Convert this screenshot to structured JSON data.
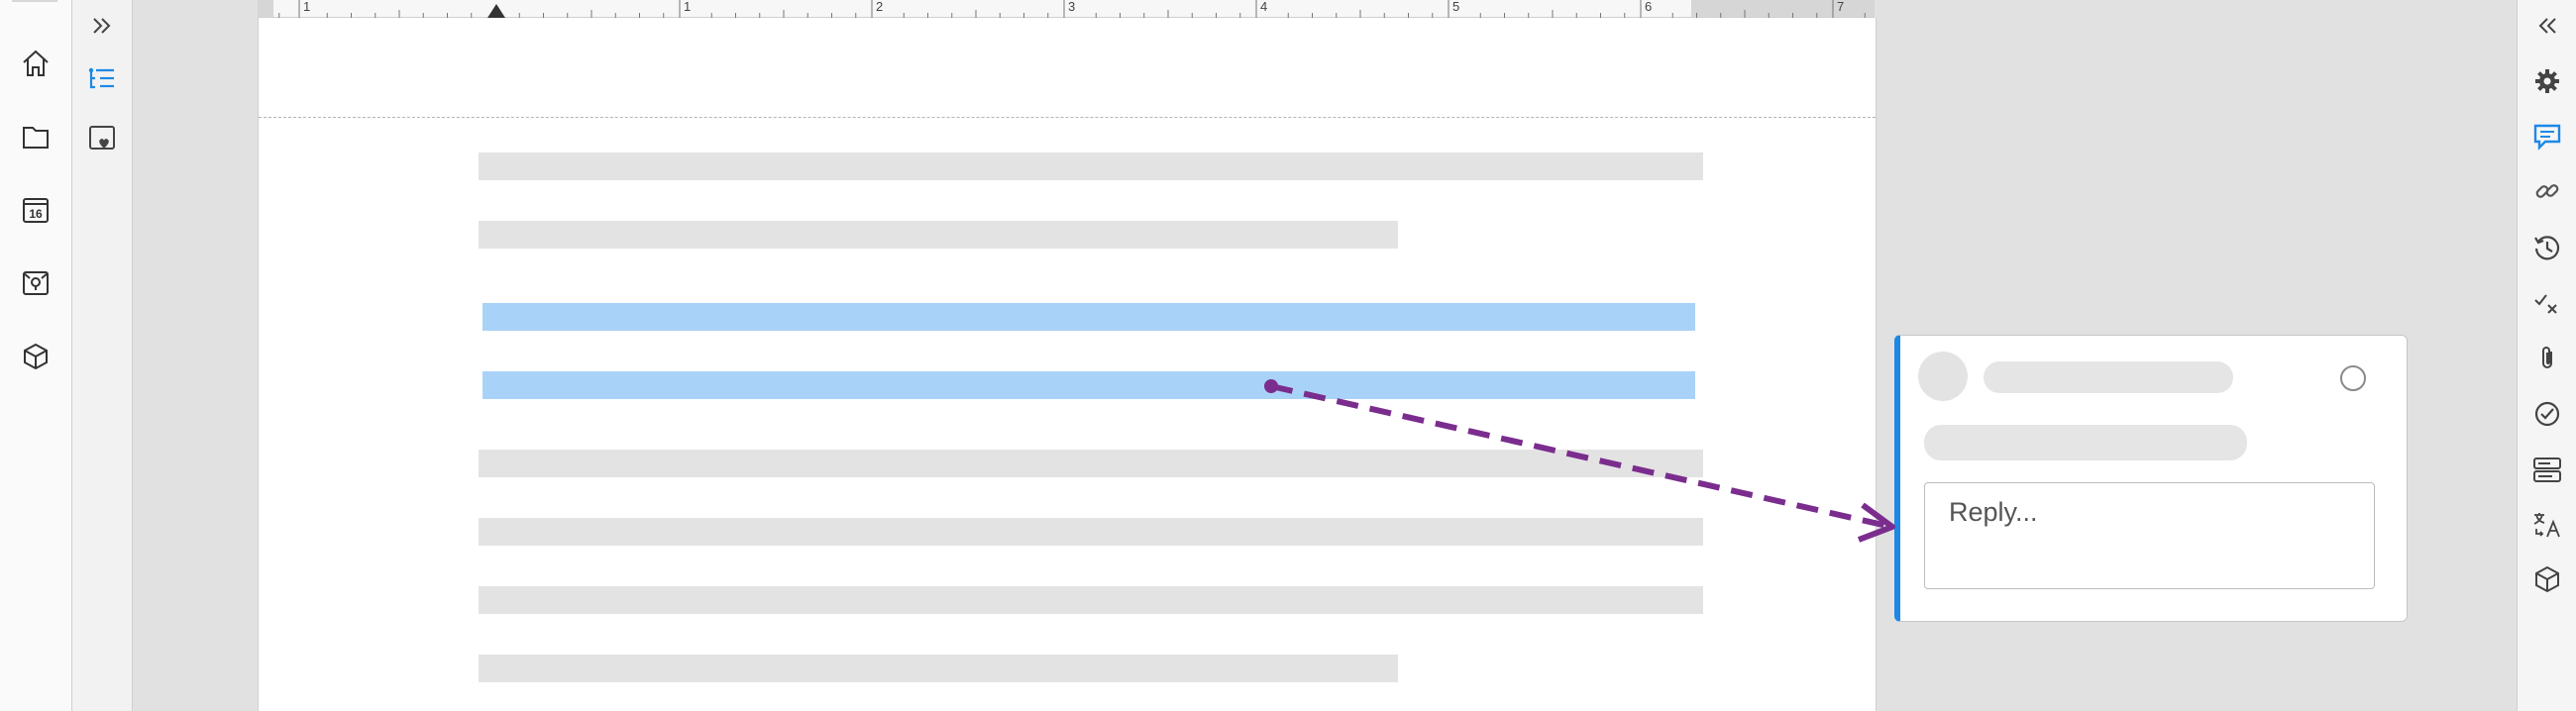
{
  "ruler": {
    "labels": [
      "1",
      "1",
      "2",
      "3",
      "4",
      "5",
      "6",
      "7"
    ]
  },
  "app_sidebar": {
    "icons": [
      "home-icon",
      "folder-icon",
      "calendar-icon",
      "sticky-notes-icon",
      "package-icon"
    ],
    "calendar_day": "16"
  },
  "sec_toolbar": {
    "icons": [
      "expand-icon",
      "outline-icon",
      "favorites-icon"
    ]
  },
  "right_sidebar": {
    "icons": [
      "collapse-icon",
      "settings-icon",
      "comments-icon",
      "link-icon",
      "history-icon",
      "track-changes-icon",
      "attachment-icon",
      "check-icon",
      "forms-icon",
      "translate-icon",
      "extensions-icon"
    ],
    "active": "comments-icon",
    "accent": "#1e88e5"
  },
  "comment": {
    "reply_placeholder": "Reply...",
    "accent": "#1e88e5"
  },
  "annotation": {
    "arrow_color": "#7b2d8e"
  },
  "colors": {
    "selection": "#a9d2f8",
    "placeholder_line": "#e3e3e3"
  }
}
